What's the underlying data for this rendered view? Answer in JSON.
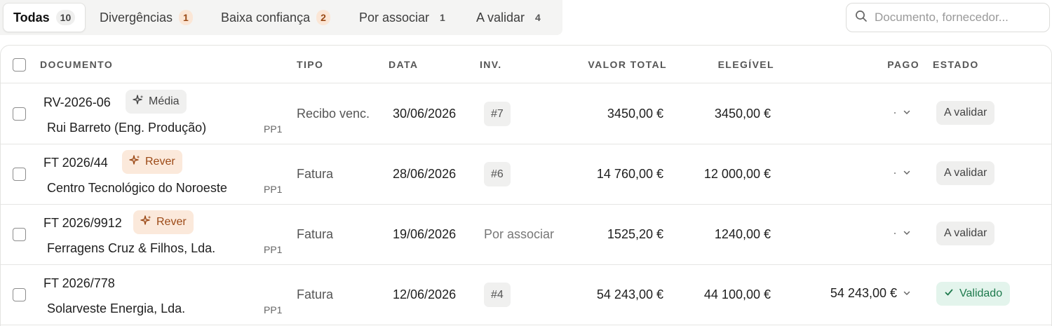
{
  "tabs": [
    {
      "label": "Todas",
      "count": "10"
    },
    {
      "label": "Divergências",
      "count": "1"
    },
    {
      "label": "Baixa confiança",
      "count": "2"
    },
    {
      "label": "Por associar",
      "count": "1"
    },
    {
      "label": "A validar",
      "count": "4"
    }
  ],
  "search": {
    "placeholder": "Documento, fornecedor..."
  },
  "columns": {
    "documento": "DOCUMENTO",
    "tipo": "TIPO",
    "data": "DATA",
    "inv": "INV.",
    "valor_total": "VALOR TOTAL",
    "elegivel": "ELEGÍVEL",
    "pago": "PAGO",
    "estado": "ESTADO"
  },
  "rows": [
    {
      "doc": "RV-2026-06",
      "badge": "Média",
      "supplier": "Rui Barreto (Eng. Produção)",
      "pp": "PP1",
      "tipo": "Recibo venc.",
      "data": "30/06/2026",
      "inv": "#7",
      "valor": "3450,00 €",
      "elegivel": "3450,00 €",
      "pago": "·",
      "estado": "A validar"
    },
    {
      "doc": "FT 2026/44",
      "badge": "Rever",
      "supplier": "Centro Tecnológico do Noroeste",
      "pp": "PP1",
      "tipo": "Fatura",
      "data": "28/06/2026",
      "inv": "#6",
      "valor": "14 760,00 €",
      "elegivel": "12 000,00 €",
      "pago": "·",
      "estado": "A validar"
    },
    {
      "doc": "FT 2026/9912",
      "badge": "Rever",
      "supplier": "Ferragens Cruz & Filhos, Lda.",
      "pp": "PP1",
      "tipo": "Fatura",
      "data": "19/06/2026",
      "inv": "Por associar",
      "valor": "1525,20 €",
      "elegivel": "1240,00 €",
      "pago": "·",
      "estado": "A validar"
    },
    {
      "doc": "FT 2026/778",
      "badge": "",
      "supplier": "Solarveste Energia, Lda.",
      "pp": "PP1",
      "tipo": "Fatura",
      "data": "12/06/2026",
      "inv": "#4",
      "valor": "54 243,00 €",
      "elegivel": "44 100,00 €",
      "pago": "54 243,00 €",
      "estado": "Validado"
    }
  ],
  "colors": {
    "warn_bg": "#fbe9db",
    "warn_fg": "#9c4a17",
    "ok_bg": "#e3f4ec",
    "ok_fg": "#1e7a4d"
  },
  "icons": {
    "search": "search-icon",
    "sparkle": "sparkle-icon",
    "chevron": "chevron-down-icon",
    "check": "check-icon"
  }
}
